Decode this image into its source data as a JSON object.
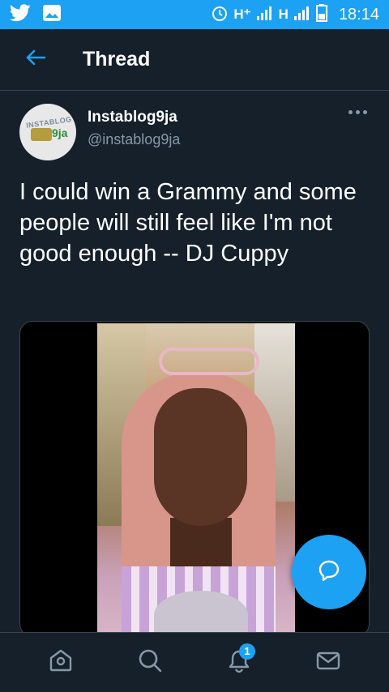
{
  "status_bar": {
    "network_labels": [
      "H⁺",
      "H"
    ],
    "time": "18:14",
    "icons": [
      "twitter-bird-icon",
      "image-icon",
      "alarm-icon",
      "signal-icon",
      "signal-icon",
      "battery-icon"
    ]
  },
  "header": {
    "title": "Thread",
    "back_icon": "arrow-left-icon"
  },
  "tweet": {
    "avatar_logo": "INSTABLOG 9ja",
    "display_name": "Instablog9ja",
    "handle": "@instablog9ja",
    "text": "I could win a Grammy and some people will still feel like I'm not good enough -- DJ Cuppy"
  },
  "bottom_nav": {
    "items": [
      "home-icon",
      "search-icon",
      "notifications-icon",
      "messages-icon"
    ],
    "notifications_badge": "1"
  },
  "colors": {
    "background": "#15202b",
    "accent": "#1da1f2",
    "secondary_text": "#8899a6",
    "divider": "#38444d"
  }
}
